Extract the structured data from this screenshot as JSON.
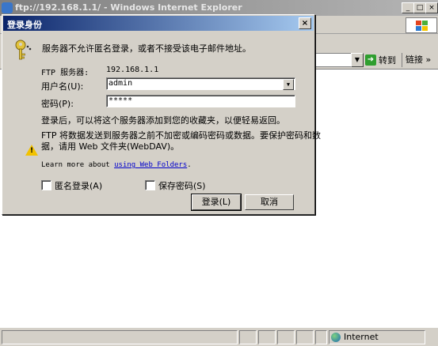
{
  "browser": {
    "title": "ftp://192.168.1.1/ - Windows Internet Explorer",
    "window_buttons": {
      "minimize": "_",
      "maximize": "□",
      "close": "×"
    },
    "address": {
      "go_label": "转到",
      "links_label": "链接",
      "links_chevron": "»",
      "dropdown": "▼"
    },
    "status": {
      "zone": "Internet"
    }
  },
  "dialog": {
    "title": "登录身份",
    "close": "×",
    "message": "服务器不允许匿名登录，或者不接受该电子邮件地址。",
    "server_label": "FTP 服务器:",
    "server_value": "192.168.1.1",
    "username_label": "用户名(U):",
    "username_value": "admin",
    "password_label": "密码(P):",
    "password_value": "*****",
    "info_text": "登录后，可以将这个服务器添加到您的收藏夹，以便轻易返回。",
    "warning_line1": "FTP 将数据发送到服务器之前不加密或编码密码或数据。要保护密码和数",
    "warning_line2": "据，请用 Web 文件夹(WebDAV)。",
    "learn_prefix": "Learn more about",
    "learn_link": "using Web Folders",
    "learn_suffix": ".",
    "anonymous_label": "匿名登录(A)",
    "save_password_label": "保存密码(S)",
    "login_button": "登录(L)",
    "cancel_button": "取消"
  }
}
